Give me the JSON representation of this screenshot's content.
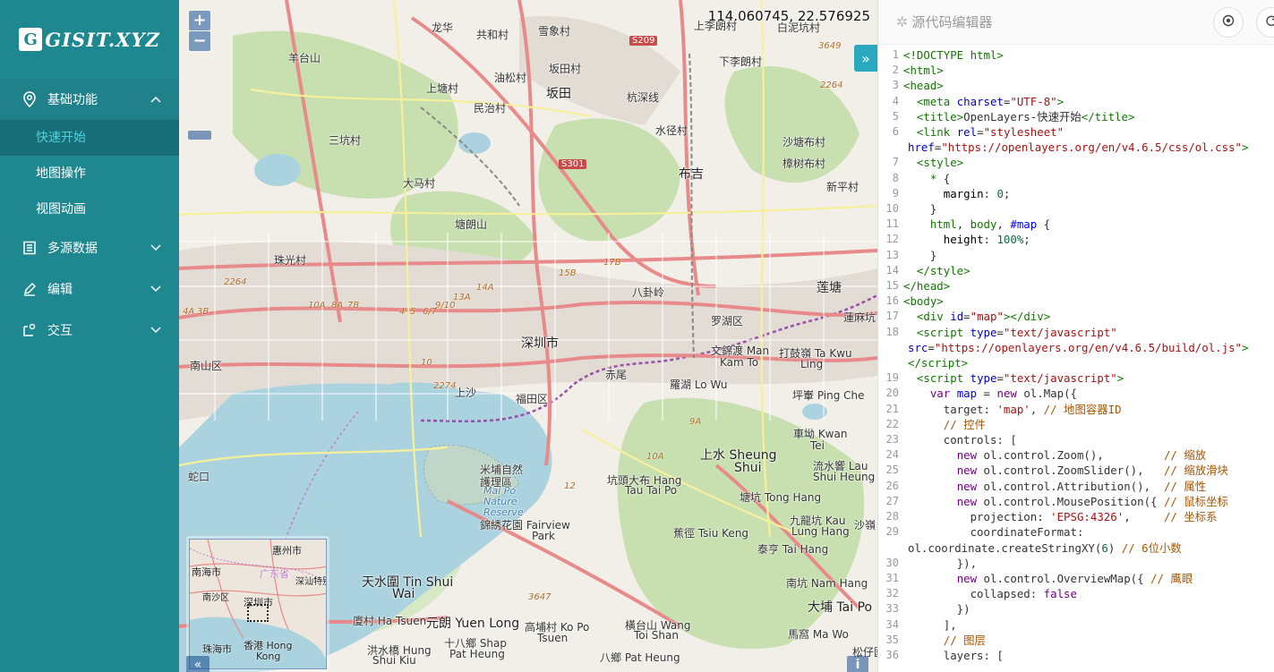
{
  "logo": {
    "mark": "G",
    "text": "GISIT.XYZ"
  },
  "sidebar": {
    "groups": [
      {
        "label": "基础功能",
        "icon": "location-pin-icon",
        "open": true,
        "items": [
          "快速开始",
          "地图操作",
          "视图动画"
        ],
        "active": "快速开始"
      },
      {
        "label": "多源数据",
        "icon": "list-icon"
      },
      {
        "label": "编辑",
        "icon": "pen-icon"
      },
      {
        "label": "交互",
        "icon": "interaction-icon"
      }
    ]
  },
  "map": {
    "mouse_position": "114.060745, 22.576925",
    "zoom_in": "+",
    "zoom_out": "−",
    "labels": [
      {
        "t": "龙华",
        "c": ""
      },
      {
        "t": "共和村",
        "c": ""
      },
      {
        "t": "雪象村",
        "c": ""
      },
      {
        "t": "上李朗村",
        "c": ""
      },
      {
        "t": "白泥坑村",
        "c": ""
      },
      {
        "t": "羊台山",
        "c": ""
      },
      {
        "t": "油松村",
        "c": ""
      },
      {
        "t": "坂田村",
        "c": ""
      },
      {
        "t": "下李朗村",
        "c": ""
      },
      {
        "t": "上塘村",
        "c": ""
      },
      {
        "t": "坂田",
        "c": "big"
      },
      {
        "t": "民治村",
        "c": ""
      },
      {
        "t": "杭深线",
        "c": ""
      },
      {
        "t": "三坑村",
        "c": ""
      },
      {
        "t": "水径村",
        "c": ""
      },
      {
        "t": "沙塘布村",
        "c": ""
      },
      {
        "t": "樟树布村",
        "c": ""
      },
      {
        "t": "布吉",
        "c": "big"
      },
      {
        "t": "大马村",
        "c": ""
      },
      {
        "t": "新平村",
        "c": ""
      },
      {
        "t": "塘朗山",
        "c": ""
      },
      {
        "t": "珠光村",
        "c": ""
      },
      {
        "t": "八卦岭",
        "c": ""
      },
      {
        "t": "莲塘",
        "c": "big"
      },
      {
        "t": "罗湖区",
        "c": ""
      },
      {
        "t": "深圳市",
        "c": "big"
      },
      {
        "t": "蓮麻坑 L",
        "c": ""
      },
      {
        "t": "南山区",
        "c": ""
      },
      {
        "t": "文錦渡 Man",
        "c": ""
      },
      {
        "t": "Kam To",
        "c": ""
      },
      {
        "t": "打鼓嶺 Ta Kwu",
        "c": ""
      },
      {
        "t": "Ling",
        "c": ""
      },
      {
        "t": "赤尾",
        "c": ""
      },
      {
        "t": "上沙",
        "c": ""
      },
      {
        "t": "福田区",
        "c": ""
      },
      {
        "t": "羅湖 Lo Wu",
        "c": ""
      },
      {
        "t": "坪輋 Ping Che",
        "c": ""
      },
      {
        "t": "蛇口",
        "c": ""
      },
      {
        "t": "車坳 Kwan",
        "c": ""
      },
      {
        "t": "Tei",
        "c": ""
      },
      {
        "t": "上水 Sheung",
        "c": "big"
      },
      {
        "t": "Shui",
        "c": "big"
      },
      {
        "t": "米埔自然",
        "c": ""
      },
      {
        "t": "護理區",
        "c": ""
      },
      {
        "t": "Mai Po",
        "c": "water"
      },
      {
        "t": "Nature",
        "c": "water"
      },
      {
        "t": "Reserve",
        "c": "water"
      },
      {
        "t": "坑頭大布 Hang",
        "c": ""
      },
      {
        "t": "Tau Tai Po",
        "c": ""
      },
      {
        "t": "流水響 Lau",
        "c": ""
      },
      {
        "t": "Shui Heung",
        "c": ""
      },
      {
        "t": "塘坑 Tong Hang",
        "c": ""
      },
      {
        "t": "錦綉花園 Fairview",
        "c": ""
      },
      {
        "t": "Park",
        "c": ""
      },
      {
        "t": "九龍坑 Kau",
        "c": ""
      },
      {
        "t": "Lung Hang",
        "c": ""
      },
      {
        "t": "沙嶺",
        "c": ""
      },
      {
        "t": "蕉徑 Tsiu Keng",
        "c": ""
      },
      {
        "t": "泰亨 Tai Hang",
        "c": ""
      },
      {
        "t": "天水圍 Tin Shui",
        "c": "big"
      },
      {
        "t": "Wai",
        "c": "big"
      },
      {
        "t": "南坑 Nam Hang",
        "c": ""
      },
      {
        "t": "大埔 Tai Po",
        "c": "big"
      },
      {
        "t": "廈村 Ha Tsuen",
        "c": ""
      },
      {
        "t": "元朗 Yuen Long",
        "c": "big"
      },
      {
        "t": "高埔村 Ko Po",
        "c": ""
      },
      {
        "t": "Tsuen",
        "c": ""
      },
      {
        "t": "橫台山 Wang",
        "c": ""
      },
      {
        "t": "Toi Shan",
        "c": ""
      },
      {
        "t": "馬窩 Ma Wo",
        "c": ""
      },
      {
        "t": "松仔園",
        "c": ""
      },
      {
        "t": "十八鄉 Shap",
        "c": ""
      },
      {
        "t": "Pat Heung",
        "c": ""
      },
      {
        "t": "洪水橋 Hung",
        "c": ""
      },
      {
        "t": "Shui Kiu",
        "c": ""
      },
      {
        "t": "八鄉 Pat Heung",
        "c": ""
      }
    ],
    "roads": [
      "S209",
      "S301",
      "15B",
      "17B",
      "14A",
      "13A",
      "10A",
      "8A",
      "7B",
      "9/10",
      "4",
      "5",
      "6/7",
      "3B",
      "4A",
      "2264",
      "2274",
      "10",
      "9A",
      "10A",
      "12",
      "3647",
      "3649",
      "2264"
    ],
    "overview": {
      "labels": [
        "惠州市",
        "广东省",
        "深汕特别合作区",
        "南海市",
        "南沙区",
        "深圳市",
        "珠海市",
        "香港 Hong",
        "Kong"
      ]
    }
  },
  "editor": {
    "title": "源代码编辑器",
    "lines": [
      {
        "n": "1",
        "h": "<span class='c-tag'>&lt;!DOCTYPE html&gt;</span>"
      },
      {
        "n": "2",
        "h": "<span class='c-tag'>&lt;html&gt;</span>"
      },
      {
        "n": "3",
        "h": "<span class='c-tag'>&lt;head&gt;</span>"
      },
      {
        "n": "4",
        "h": "  <span class='c-tag'>&lt;meta</span> <span class='c-attr'>charset</span>=<span class='c-str'>\"UTF-8\"</span><span class='c-tag'>&gt;</span>"
      },
      {
        "n": "5",
        "h": "  <span class='c-tag'>&lt;title&gt;</span>OpenLayers-快速开始<span class='c-tag'>&lt;/title&gt;</span>"
      },
      {
        "n": "6",
        "h": "  <span class='c-tag'>&lt;link</span> <span class='c-attr'>rel</span>=<span class='c-str'>\"stylesheet\"</span>"
      },
      {
        "n": "",
        "h": "<span class='c-attr'>href</span>=<span class='c-str'>\"https://openlayers.org/en/v4.6.5/css/ol.css\"</span><span class='c-tag'>&gt;</span>",
        "wrap": true
      },
      {
        "n": "7",
        "h": "  <span class='c-tag'>&lt;style&gt;</span>"
      },
      {
        "n": "8",
        "h": "    <span class='c-tag'>*</span> {"
      },
      {
        "n": "9",
        "h": "      <span class='c-prop'>margin</span>: <span class='c-num'>0</span>;"
      },
      {
        "n": "10",
        "h": "    }"
      },
      {
        "n": "11",
        "h": "    <span class='c-tag'>html</span>, <span class='c-tag'>body</span>, <span class='c-def'>#map</span> {"
      },
      {
        "n": "12",
        "h": "      <span class='c-prop'>height</span>: <span class='c-num'>100%</span>;"
      },
      {
        "n": "13",
        "h": "    }"
      },
      {
        "n": "14",
        "h": "  <span class='c-tag'>&lt;/style&gt;</span>"
      },
      {
        "n": "15",
        "h": "<span class='c-tag'>&lt;/head&gt;</span>"
      },
      {
        "n": "16",
        "h": "<span class='c-tag'>&lt;body&gt;</span>"
      },
      {
        "n": "17",
        "h": "  <span class='c-tag'>&lt;div</span> <span class='c-attr'>id</span>=<span class='c-str'>\"map\"</span><span class='c-tag'>&gt;&lt;/div&gt;</span>"
      },
      {
        "n": "18",
        "h": "  <span class='c-tag'>&lt;script</span> <span class='c-attr'>type</span>=<span class='c-str'>\"text/javascript\"</span>"
      },
      {
        "n": "",
        "h": "<span class='c-attr'>src</span>=<span class='c-str'>\"https://openlayers.org/en/v4.6.5/build/ol.js\"</span><span class='c-tag'>&gt;</span>",
        "wrap": true
      },
      {
        "n": "",
        "h": "<span class='c-tag'>&lt;/script&gt;</span>",
        "wrap": true
      },
      {
        "n": "19",
        "h": "  <span class='c-tag'>&lt;script</span> <span class='c-attr'>type</span>=<span class='c-str'>\"text/javascript\"</span><span class='c-tag'>&gt;</span>"
      },
      {
        "n": "20",
        "h": "    <span class='c-kw'>var</span> <span class='c-def'>map</span> = <span class='c-kw'>new</span> ol.Map({"
      },
      {
        "n": "21",
        "h": "      target: <span class='c-str'>'map'</span>, <span class='c-com'>// 地图容器ID</span>"
      },
      {
        "n": "22",
        "h": "      <span class='c-com'>// 控件</span>"
      },
      {
        "n": "23",
        "h": "      controls: ["
      },
      {
        "n": "24",
        "h": "        <span class='c-kw'>new</span> ol.control.Zoom(),         <span class='c-com'>// 缩放</span>"
      },
      {
        "n": "25",
        "h": "        <span class='c-kw'>new</span> ol.control.ZoomSlider(),   <span class='c-com'>// 缩放滑块</span>"
      },
      {
        "n": "26",
        "h": "        <span class='c-kw'>new</span> ol.control.Attribution(),  <span class='c-com'>// 属性</span>"
      },
      {
        "n": "27",
        "h": "        <span class='c-kw'>new</span> ol.control.MousePosition({ <span class='c-com'>// 鼠标坐标</span>"
      },
      {
        "n": "28",
        "h": "          projection: <span class='c-str'>'EPSG:4326'</span>,     <span class='c-com'>// 坐标系</span>"
      },
      {
        "n": "29",
        "h": "          coordinateFormat:"
      },
      {
        "n": "",
        "h": "ol.coordinate.createStringXY(<span class='c-num'>6</span>) <span class='c-com'>// 6位小数</span>",
        "wrap": true
      },
      {
        "n": "30",
        "h": "        }),"
      },
      {
        "n": "31",
        "h": "        <span class='c-kw'>new</span> ol.control.OverviewMap({ <span class='c-com'>// 鹰眼</span>"
      },
      {
        "n": "32",
        "h": "          collapsed: <span class='c-kw'>false</span>"
      },
      {
        "n": "33",
        "h": "        })"
      },
      {
        "n": "34",
        "h": "      ],"
      },
      {
        "n": "35",
        "h": "      <span class='c-com'>// 图层</span>"
      },
      {
        "n": "36",
        "h": "      layers: ["
      }
    ]
  },
  "colors": {
    "sidebar": "#1f8790",
    "active_sub_bg": "#186e76",
    "active_sub_text": "#4fd1dc",
    "map_bg": "#f2efe9"
  }
}
